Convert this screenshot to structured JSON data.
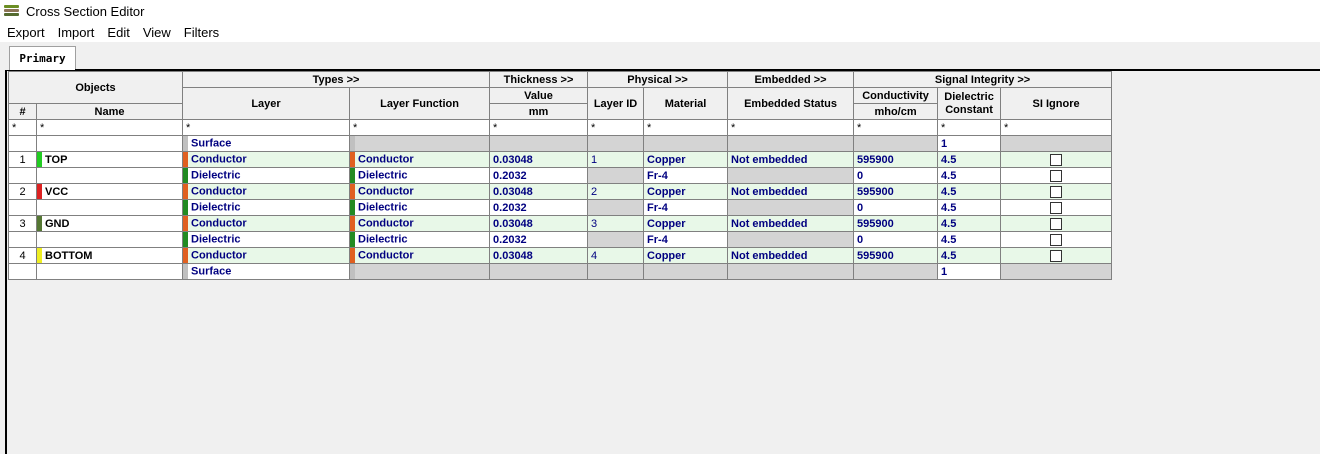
{
  "window": {
    "title": "Cross Section Editor"
  },
  "menu": [
    "Export",
    "Import",
    "Edit",
    "View",
    "Filters"
  ],
  "tab": "Primary",
  "headers": {
    "groups": {
      "objects": "Objects",
      "types": "Types >>",
      "thickness": "Thickness >>",
      "physical": "Physical >>",
      "embedded": "Embedded >>",
      "si": "Signal Integrity >>"
    },
    "cols": {
      "num": "#",
      "name": "Name",
      "layer": "Layer",
      "layer_function": "Layer Function",
      "value": "Value",
      "value_unit": "mm",
      "layer_id": "Layer ID",
      "material": "Material",
      "embedded_status": "Embedded Status",
      "conductivity": "Conductivity",
      "conductivity_unit": "mho/cm",
      "dielectric_constant": "Dielectric Constant",
      "si_ignore": "SI Ignore"
    },
    "filter": "*"
  },
  "colors": {
    "conductor_orange": "#e06020",
    "dielectric_green": "#228b22",
    "surface_gray": "#c0c0c0",
    "top": "#22cc22",
    "vcc": "#dd2222",
    "gnd": "#557733",
    "bottom": "#eeee22"
  },
  "rows": [
    {
      "kind": "surf",
      "num": "",
      "name": "",
      "layer": "Surface",
      "func": "",
      "thick": "",
      "id": "",
      "material": "",
      "embedded": "",
      "cond": "",
      "dk": "1",
      "ignore": false
    },
    {
      "kind": "cond",
      "num": "1",
      "name": "TOP",
      "color": "top",
      "layer": "Conductor",
      "func": "Conductor",
      "thick": "0.03048",
      "id": "1",
      "material": "Copper",
      "embedded": "Not embedded",
      "cond": "595900",
      "dk": "4.5",
      "ignore": false
    },
    {
      "kind": "diel",
      "num": "",
      "name": "",
      "layer": "Dielectric",
      "func": "Dielectric",
      "thick": "0.2032",
      "id": "",
      "material": "Fr-4",
      "embedded": "",
      "cond": "0",
      "dk": "4.5",
      "ignore": false
    },
    {
      "kind": "cond",
      "num": "2",
      "name": "VCC",
      "color": "vcc",
      "layer": "Conductor",
      "func": "Conductor",
      "thick": "0.03048",
      "id": "2",
      "material": "Copper",
      "embedded": "Not embedded",
      "cond": "595900",
      "dk": "4.5",
      "ignore": false
    },
    {
      "kind": "diel",
      "num": "",
      "name": "",
      "layer": "Dielectric",
      "func": "Dielectric",
      "thick": "0.2032",
      "id": "",
      "material": "Fr-4",
      "embedded": "",
      "cond": "0",
      "dk": "4.5",
      "ignore": false
    },
    {
      "kind": "cond",
      "num": "3",
      "name": "GND",
      "color": "gnd",
      "layer": "Conductor",
      "func": "Conductor",
      "thick": "0.03048",
      "id": "3",
      "material": "Copper",
      "embedded": "Not embedded",
      "cond": "595900",
      "dk": "4.5",
      "ignore": false
    },
    {
      "kind": "diel",
      "num": "",
      "name": "",
      "layer": "Dielectric",
      "func": "Dielectric",
      "thick": "0.2032",
      "id": "",
      "material": "Fr-4",
      "embedded": "",
      "cond": "0",
      "dk": "4.5",
      "ignore": false
    },
    {
      "kind": "cond",
      "num": "4",
      "name": "BOTTOM",
      "color": "bottom",
      "layer": "Conductor",
      "func": "Conductor",
      "thick": "0.03048",
      "id": "4",
      "material": "Copper",
      "embedded": "Not embedded",
      "cond": "595900",
      "dk": "4.5",
      "ignore": false
    },
    {
      "kind": "surf",
      "num": "",
      "name": "",
      "layer": "Surface",
      "func": "",
      "thick": "",
      "id": "",
      "material": "",
      "embedded": "",
      "cond": "",
      "dk": "1",
      "ignore": false
    }
  ]
}
